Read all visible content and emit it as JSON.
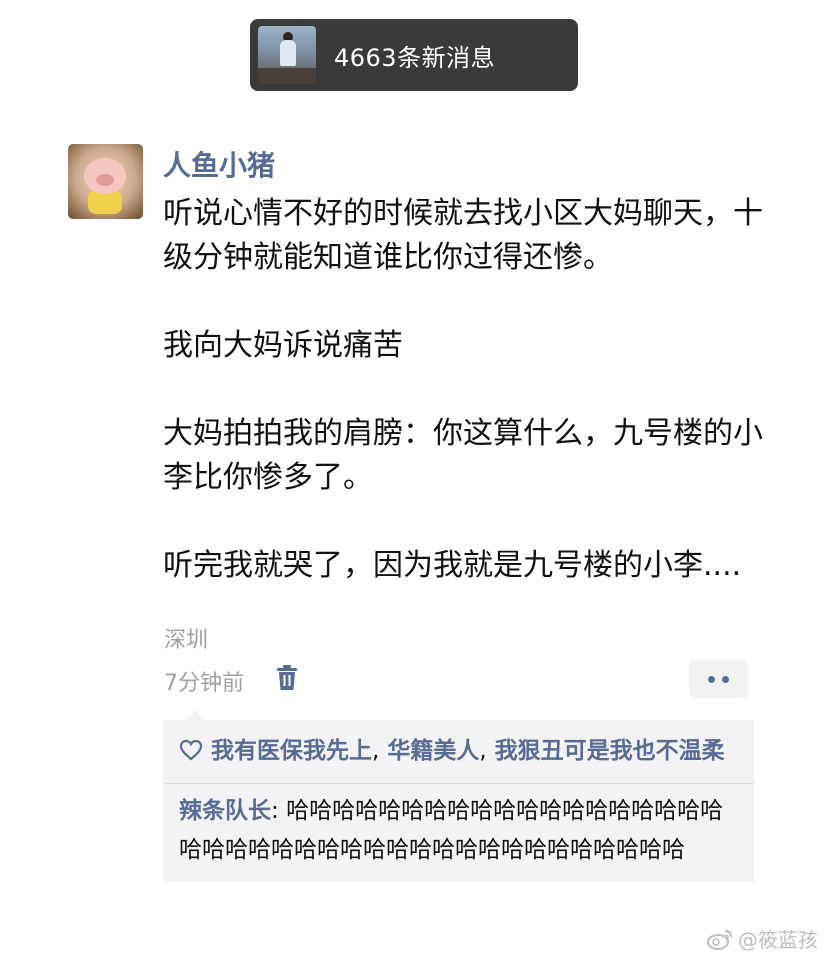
{
  "notification": {
    "text": "4663条新消息"
  },
  "post": {
    "username": "人鱼小猪",
    "paragraphs": [
      "听说心情不好的时候就去找小区大妈聊天，十级分钟就能知道谁比你过得还惨。",
      "我向大妈诉说痛苦",
      "大妈拍拍我的肩膀：你这算什么，九号楼的小李比你惨多了。",
      "听完我就哭了，因为我就是九号楼的小李...."
    ],
    "location": "深圳",
    "time": "7分钟前"
  },
  "likes": {
    "names": [
      "我有医保我先上",
      "华籍美人",
      "我狠丑可是我也不温柔"
    ],
    "separator": ","
  },
  "comments": [
    {
      "author": "辣条队长",
      "colon": ": ",
      "text": "哈哈哈哈哈哈哈哈哈哈哈哈哈哈哈哈哈哈哈哈哈哈哈哈哈哈哈哈哈哈哈哈哈哈哈哈哈哈哈哈哈"
    }
  ],
  "watermark": {
    "text": "@筱蓝孩"
  },
  "colors": {
    "link_blue": "#576b95",
    "pill_bg": "#3a3a3a",
    "comment_bg": "#f3f3f5",
    "meta_gray": "#a0a0a0"
  },
  "icons": {
    "delete": "trash-icon",
    "more": "more-dots-icon",
    "like": "heart-icon",
    "watermark": "weibo-icon"
  }
}
